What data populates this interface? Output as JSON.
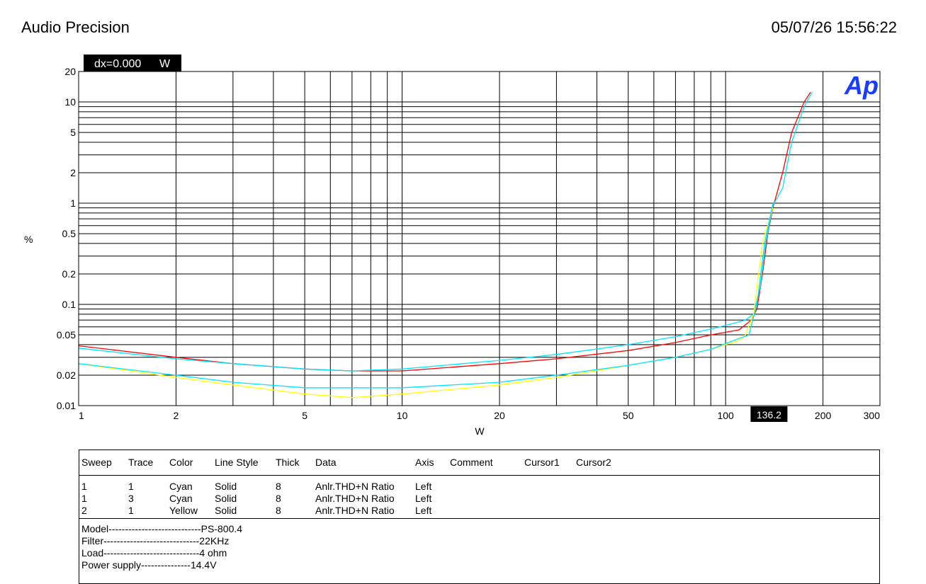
{
  "header": {
    "app_title": "Audio Precision",
    "timestamp": "05/07/26 15:56:22"
  },
  "cursor": {
    "readout": "dx=0.000",
    "unit": "W",
    "marker_label": "136.2",
    "x_value": 136.2
  },
  "logo": {
    "text": "Ap",
    "color": "#1a3cff"
  },
  "chart_data": {
    "type": "line",
    "xlabel": "W",
    "ylabel": "%",
    "xscale": "log",
    "yscale": "log",
    "xlim": [
      1,
      300
    ],
    "ylim": [
      0.01,
      20
    ],
    "xticks": [
      1,
      2,
      5,
      10,
      20,
      50,
      100,
      200,
      300
    ],
    "xtick_labels": [
      "1",
      "2",
      "5",
      "10",
      "20",
      "50",
      "100",
      "200",
      "300"
    ],
    "yticks": [
      20,
      10,
      5,
      2,
      1,
      0.5,
      0.2,
      0.1,
      0.05,
      0.02,
      0.01
    ],
    "ytick_labels": [
      "20",
      "10",
      "5",
      "2",
      "1",
      "0.5",
      "0.2",
      "0.1",
      "0.05",
      "0.02",
      "0.01"
    ],
    "grid": true,
    "series": [
      {
        "color": "#ff0000",
        "points": [
          [
            1,
            0.039
          ],
          [
            2,
            0.03
          ],
          [
            3,
            0.026
          ],
          [
            5,
            0.023
          ],
          [
            7,
            0.022
          ],
          [
            10,
            0.022
          ],
          [
            20,
            0.026
          ],
          [
            30,
            0.029
          ],
          [
            50,
            0.035
          ],
          [
            70,
            0.042
          ],
          [
            90,
            0.05
          ],
          [
            100,
            0.053
          ],
          [
            110,
            0.056
          ],
          [
            120,
            0.07
          ],
          [
            125,
            0.09
          ],
          [
            130,
            0.2
          ],
          [
            135,
            0.5
          ],
          [
            140,
            0.9
          ],
          [
            150,
            2.0
          ],
          [
            160,
            5.0
          ],
          [
            175,
            10.0
          ],
          [
            183,
            12.5
          ]
        ]
      },
      {
        "color": "#00e5ff",
        "points": [
          [
            1,
            0.037
          ],
          [
            2,
            0.029
          ],
          [
            3,
            0.026
          ],
          [
            5,
            0.023
          ],
          [
            7,
            0.022
          ],
          [
            10,
            0.023
          ],
          [
            20,
            0.028
          ],
          [
            30,
            0.032
          ],
          [
            50,
            0.04
          ],
          [
            70,
            0.048
          ],
          [
            90,
            0.057
          ],
          [
            100,
            0.062
          ],
          [
            115,
            0.07
          ],
          [
            122,
            0.08
          ],
          [
            128,
            0.15
          ],
          [
            133,
            0.4
          ],
          [
            140,
            0.95
          ],
          [
            150,
            1.4
          ],
          [
            160,
            4.0
          ],
          [
            175,
            9.0
          ],
          [
            185,
            12.5
          ]
        ]
      },
      {
        "color": "#ffff00",
        "points": [
          [
            1,
            0.026
          ],
          [
            2,
            0.019
          ],
          [
            3,
            0.016
          ],
          [
            5,
            0.013
          ],
          [
            7,
            0.012
          ],
          [
            10,
            0.013
          ],
          [
            20,
            0.016
          ],
          [
            30,
            0.019
          ],
          [
            50,
            0.025
          ],
          [
            70,
            0.03
          ],
          [
            90,
            0.036
          ],
          [
            100,
            0.04
          ],
          [
            110,
            0.044
          ],
          [
            115,
            0.05
          ],
          [
            122,
            0.08
          ],
          [
            130,
            0.4
          ],
          [
            140,
            0.9
          ]
        ]
      },
      {
        "color": "#00e5ff",
        "points": [
          [
            1,
            0.026
          ],
          [
            2,
            0.02
          ],
          [
            3,
            0.017
          ],
          [
            5,
            0.015
          ],
          [
            7,
            0.015
          ],
          [
            10,
            0.015
          ],
          [
            20,
            0.017
          ],
          [
            30,
            0.02
          ],
          [
            50,
            0.025
          ],
          [
            70,
            0.03
          ],
          [
            90,
            0.036
          ],
          [
            100,
            0.041
          ],
          [
            110,
            0.046
          ],
          [
            118,
            0.05
          ],
          [
            125,
            0.1
          ],
          [
            132,
            0.4
          ],
          [
            140,
            1.0
          ]
        ]
      }
    ]
  },
  "legend": {
    "columns": [
      "Sweep",
      "Trace",
      "Color",
      "Line Style",
      "Thick",
      "Data",
      "Axis",
      "Comment",
      "Cursor1",
      "Cursor2"
    ],
    "rows": [
      [
        "1",
        "1",
        "Cyan",
        "Solid",
        "8",
        "Anlr.THD+N Ratio",
        "Left"
      ],
      [
        "1",
        "3",
        "Cyan",
        "Solid",
        "8",
        "Anlr.THD+N Ratio",
        "Left"
      ],
      [
        "2",
        "1",
        "Yellow",
        "Solid",
        "8",
        "Anlr.THD+N Ratio",
        "Left"
      ]
    ],
    "notes": [
      "Model----------------------------PS-800.4",
      "Filter-----------------------------22KHz",
      "Load-----------------------------4 ohm",
      "Power supply---------------14.4V"
    ]
  }
}
